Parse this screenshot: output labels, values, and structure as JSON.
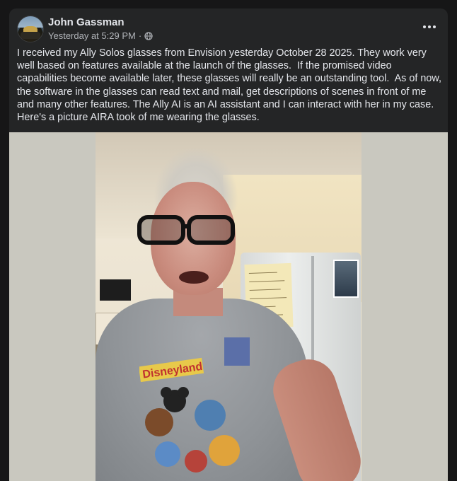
{
  "post": {
    "author": "John Gassman",
    "timestamp": "Yesterday at 5:29 PM",
    "separator": "·",
    "audience_icon": "globe-icon",
    "more_icon": "more-options-icon",
    "text": "I received my Ally Solos glasses from Envision yesterday October 28 2025. They work very well based on features available at the launch of the glasses.  If the promised video capabilities become available later, these glasses will really be an outstanding tool.  As of now, the software in the glasses can read text and mail, get descriptions of scenes in front of me and many other features. The Ally AI is an AI assistant and I can interact with her in my case.\nHere's a picture AIRA took of me wearing the glasses.",
    "photo": {
      "shirt_text": "Disneyland"
    }
  },
  "colors": {
    "page_bg": "#161617",
    "card_bg": "#242526",
    "primary_text": "#e4e6eb",
    "secondary_text": "#b0b3b8",
    "photo_side_bg": "#c9c8bf"
  }
}
